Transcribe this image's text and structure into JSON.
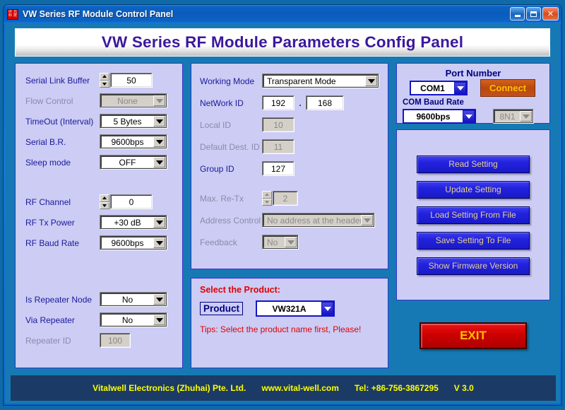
{
  "window": {
    "title": "VW Series RF Module Control Panel",
    "icon": "app-icon",
    "minimize": "_",
    "maximize": "□",
    "close": "✕"
  },
  "banner": {
    "heading": "VW  Series RF Module Parameters Config Panel"
  },
  "serial_panel": {
    "rows": [
      {
        "label": "Serial Link Buffer",
        "value": "50",
        "type": "spinner",
        "disabled": false
      },
      {
        "label": "Flow Control",
        "value": "None",
        "type": "combo",
        "disabled": true
      },
      {
        "label": "TimeOut (Interval)",
        "value": "5 Bytes",
        "type": "combo",
        "disabled": false
      },
      {
        "label": "Serial B.R.",
        "value": "9600bps",
        "type": "combo",
        "disabled": false
      },
      {
        "label": "Sleep mode",
        "value": "OFF",
        "type": "combo",
        "disabled": false
      },
      {
        "label": "RF Channel",
        "value": "0",
        "type": "spinner",
        "disabled": false
      },
      {
        "label": "RF Tx Power",
        "value": "+30 dB",
        "type": "combo",
        "disabled": false
      },
      {
        "label": "RF Baud Rate",
        "value": "9600bps",
        "type": "combo",
        "disabled": false
      },
      {
        "label": "Is Repeater Node",
        "value": "No",
        "type": "combo",
        "disabled": false
      },
      {
        "label": "Via Repeater",
        "value": "No",
        "type": "combo",
        "disabled": false
      },
      {
        "label": "Repeater  ID",
        "value": "100",
        "type": "field",
        "disabled": true
      }
    ]
  },
  "network_panel": {
    "working_mode_label": "Working Mode",
    "working_mode_value": "Transparent Mode",
    "network_id_label": "NetWork ID",
    "network_id_a": "192",
    "network_id_sep": ".",
    "network_id_b": "168",
    "local_id_label": "Local ID",
    "local_id_value": "10",
    "default_dest_label": "Default Dest. ID",
    "default_dest_value": "11",
    "group_id_label": "Group  ID",
    "group_id_value": "127",
    "max_retx_label": "Max. Re-Tx",
    "max_retx_value": "2",
    "address_control_label": "Address Control",
    "address_control_value": "No address at the header",
    "feedback_label": "Feedback",
    "feedback_value": "No"
  },
  "product_box": {
    "title": "Select the Product:",
    "tag": "Product",
    "value": "VW321A",
    "tips": "Tips:  Select the product name first,  Please!"
  },
  "port_panel": {
    "title": "Port Number",
    "com_value": "COM1",
    "connect_label": "Connect",
    "baud_label": "COM Baud Rate",
    "baud_value": "9600bps",
    "frame_value": "8N1"
  },
  "actions": {
    "buttons": [
      "Read  Setting",
      "Update  Setting",
      "Load Setting  From File",
      "Save Setting  To File",
      "Show Firmware Version"
    ],
    "exit_label": "EXIT"
  },
  "footer": {
    "company": "Vitalwell Electronics (Zhuhai)  Pte. Ltd.",
    "website": "www.vital-well.com",
    "tel": "Tel: +86-756-3867295",
    "version": "V  3.0"
  },
  "colors": {
    "panel_bg": "#ccccf5",
    "panel_border": "#3333cc",
    "client_bg": "#1779b4",
    "label": "#1a1a99",
    "accent_red": "#e00000",
    "connect_bg": "#b8480f",
    "action_btn": "#2222dd",
    "exit_btn": "#cc0000",
    "footer_bg": "#1b3b66",
    "footer_text": "#ffff00",
    "banner_text": "#3b189c"
  }
}
